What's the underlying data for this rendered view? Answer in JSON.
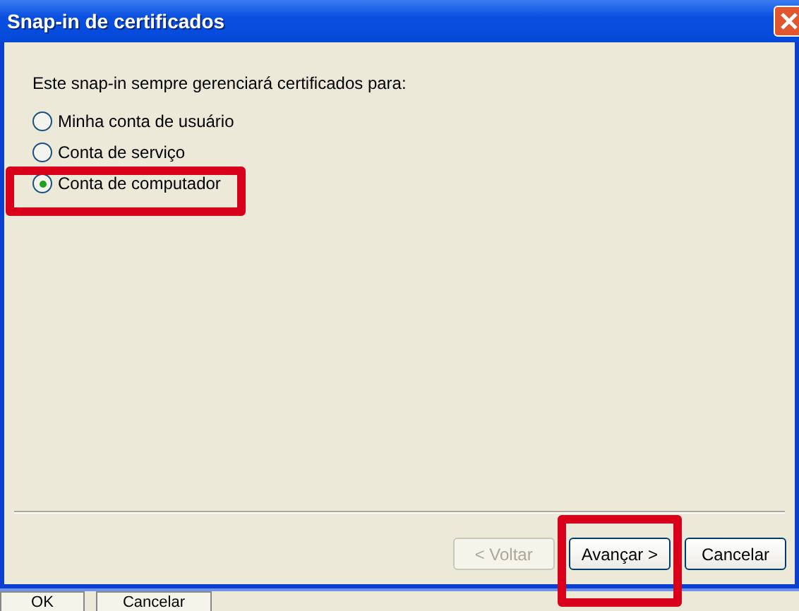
{
  "window": {
    "title": "Snap-in de certificados"
  },
  "prompt": "Este snap-in sempre gerenciará certificados para:",
  "options": [
    {
      "label": "Minha conta de usuário",
      "selected": false,
      "highlighted": false
    },
    {
      "label": "Conta de serviço",
      "selected": false,
      "highlighted": false
    },
    {
      "label": "Conta de computador",
      "selected": true,
      "highlighted": true
    }
  ],
  "buttons": [
    {
      "label": "< Voltar",
      "disabled": true,
      "highlighted": false
    },
    {
      "label": "Avançar >",
      "disabled": false,
      "highlighted": true
    },
    {
      "label": "Cancelar",
      "disabled": false,
      "highlighted": false
    }
  ],
  "background_buttons": [
    "OK",
    "Cancelar"
  ]
}
